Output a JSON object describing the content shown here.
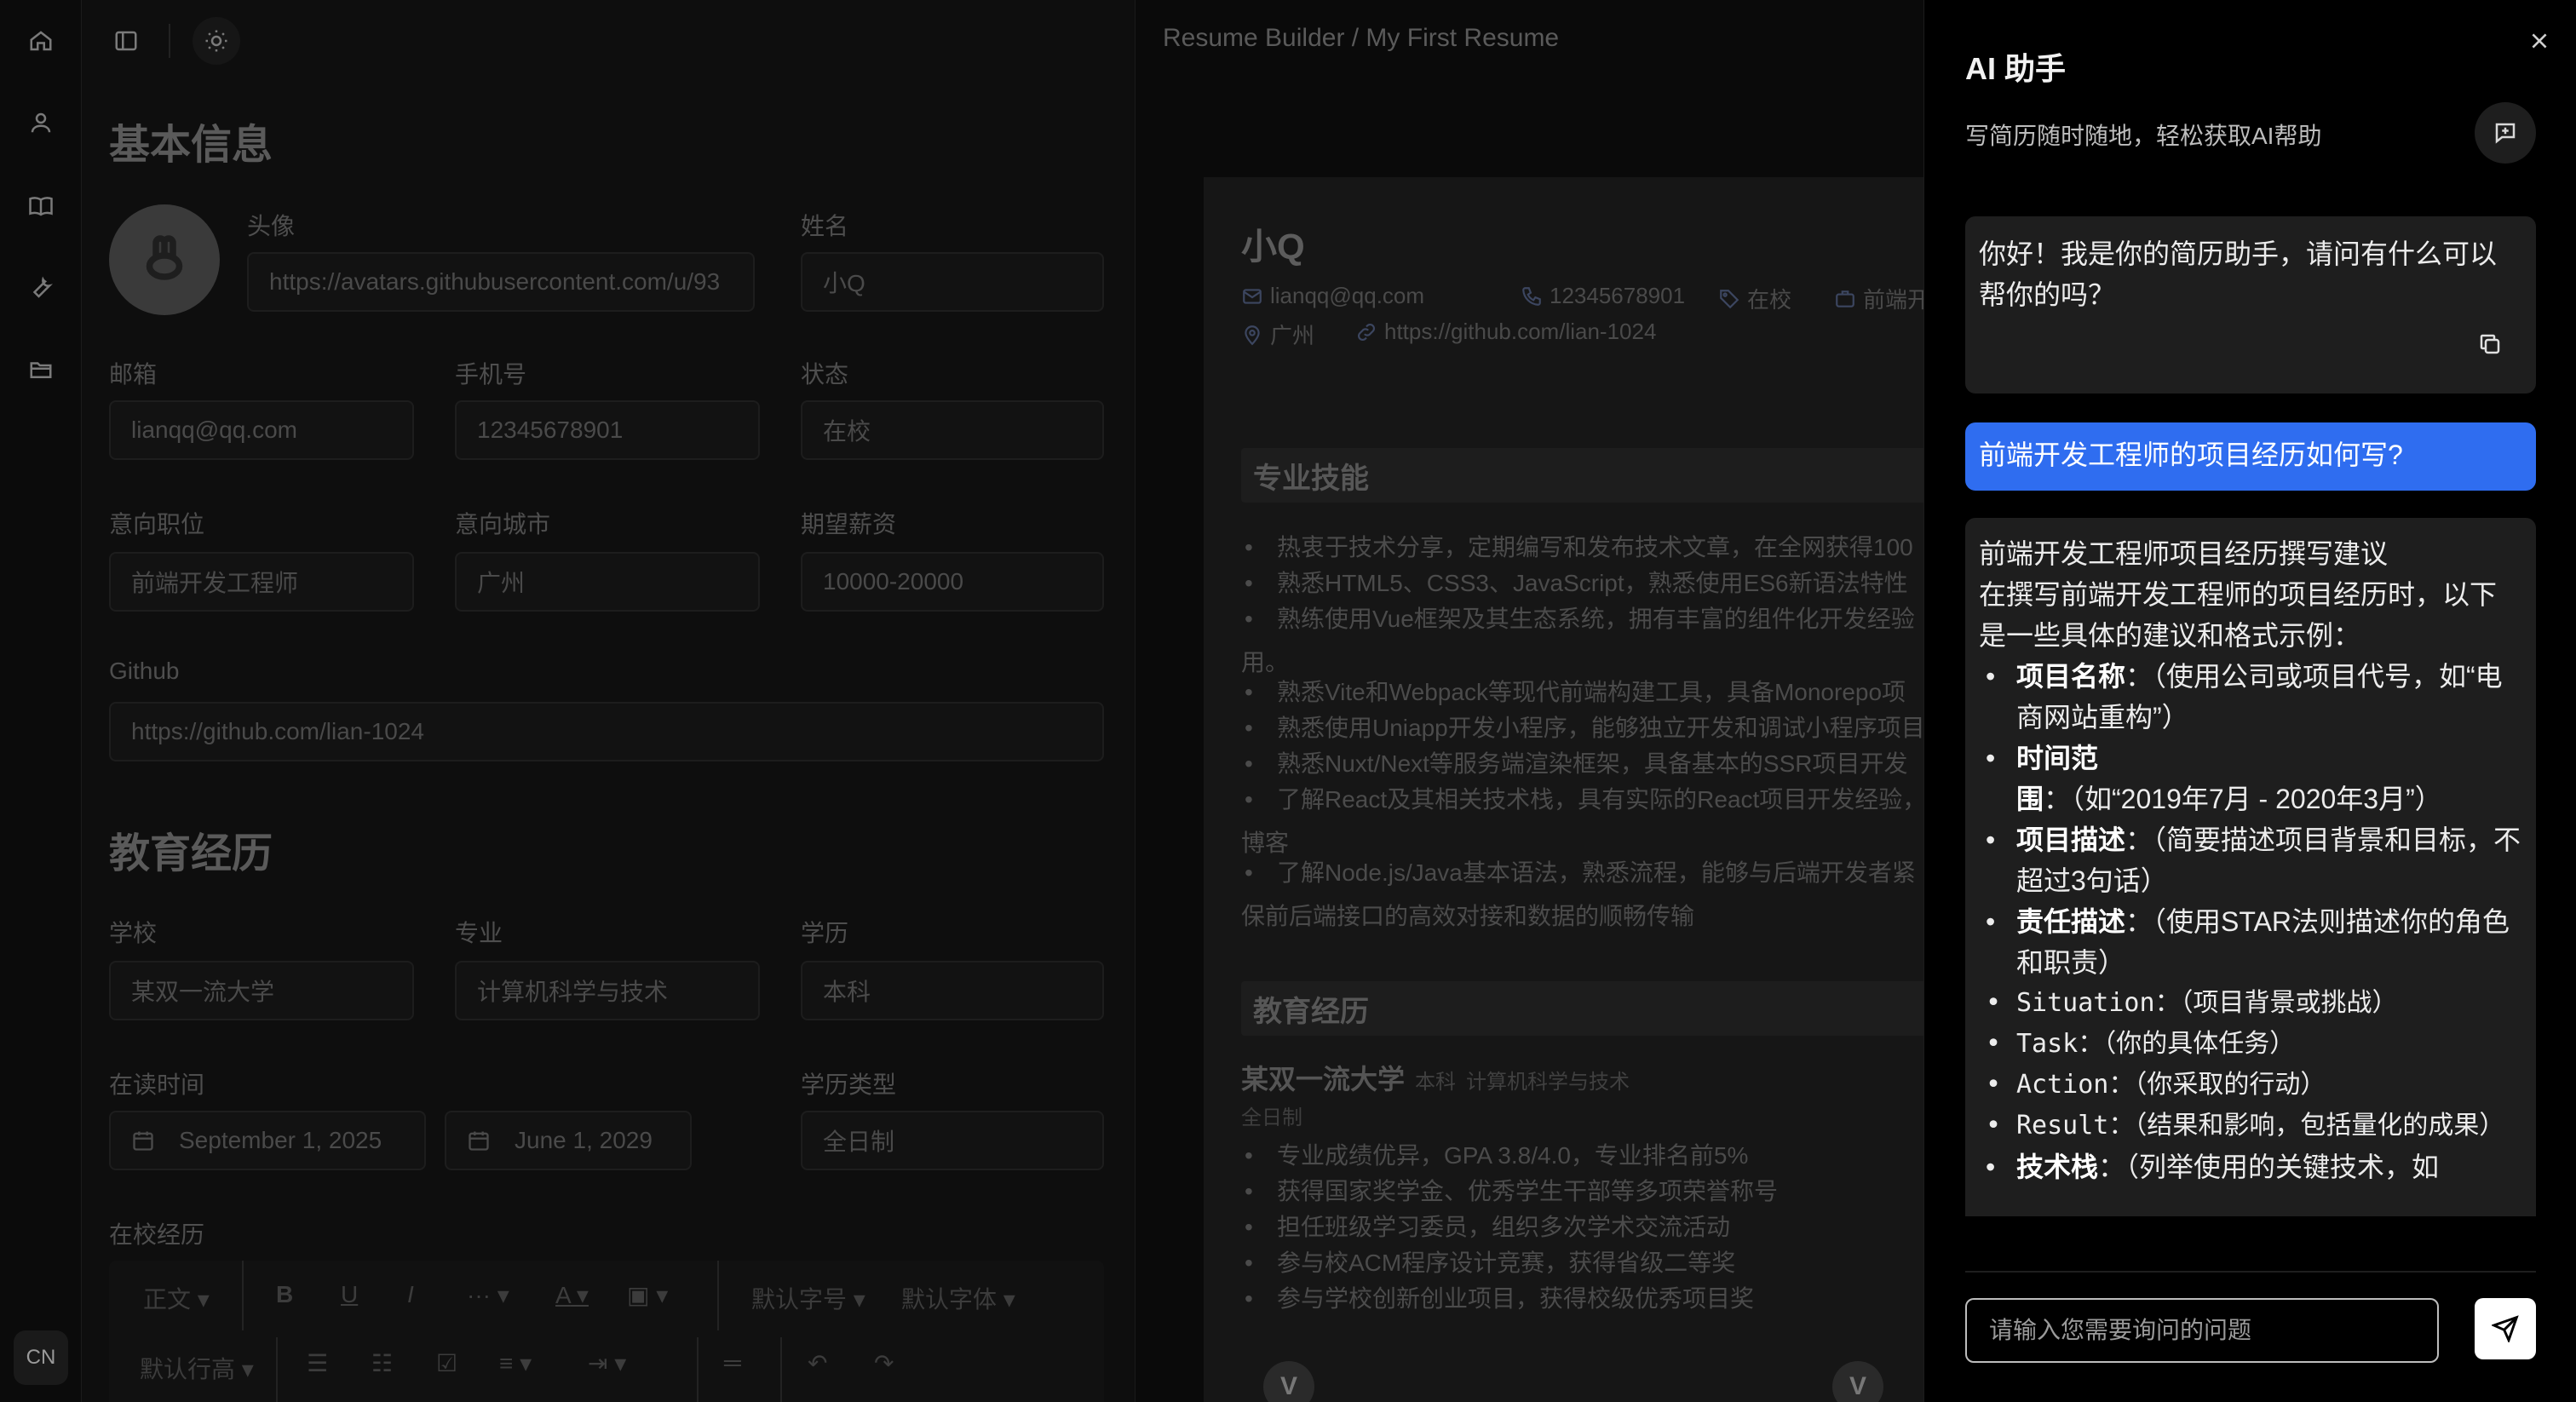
{
  "app": {
    "language_badge": "CN"
  },
  "rail": {
    "icons": [
      "home-icon",
      "user-icon",
      "book-icon",
      "wrench-icon",
      "folder-icon"
    ]
  },
  "form": {
    "basic_title": "基本信息",
    "avatar_label": "头像",
    "avatar_url": "https://avatars.githubusercontent.com/u/93",
    "name_label": "姓名",
    "name_value": "小Q",
    "email_label": "邮箱",
    "email_value": "lianqq@qq.com",
    "phone_label": "手机号",
    "phone_value": "12345678901",
    "status_label": "状态",
    "status_value": "在校",
    "position_label": "意向职位",
    "position_value": "前端开发工程师",
    "city_label": "意向城市",
    "city_value": "广州",
    "salary_label": "期望薪资",
    "salary_value": "10000-20000",
    "github_label": "Github",
    "github_value": "https://github.com/lian-1024",
    "edu_title": "教育经历",
    "school_label": "学校",
    "school_value": "某双一流大学",
    "major_label": "专业",
    "major_value": "计算机科学与技术",
    "degree_label": "学历",
    "degree_value": "本科",
    "period_label": "在读时间",
    "start_date": "September 1, 2025",
    "end_date": "June 1, 2029",
    "edu_type_label": "学历类型",
    "edu_type_value": "全日制",
    "campus_label": "在校经历",
    "toolbar": {
      "paragraph": "正文",
      "bold": "B",
      "underline": "U",
      "italic": "I",
      "more": "···",
      "font_color": "A",
      "default_size": "默认字号",
      "default_font": "默认字体",
      "default_line_height": "默认行高"
    }
  },
  "preview": {
    "breadcrumb": "Resume Builder / My First Resume",
    "name": "小Q",
    "email": "lianqq@qq.com",
    "phone": "12345678901",
    "status": "在校",
    "position": "前端开发工程",
    "city": "广州",
    "github": "https://github.com/lian-1024",
    "skills_title": "专业技能",
    "skills": [
      "热衷于技术分享，定期编写和发布技术文章，在全网获得100",
      "熟悉HTML5、CSS3、JavaScript，熟悉使用ES6新语法特性",
      "熟练使用Vue框架及其生态系统，拥有丰富的组件化开发经验",
      "熟悉Vite和Webpack等现代前端构建工具，具备Monorepo项",
      "熟悉使用Uniapp开发小程序，能够独立开发和调试小程序项目",
      "熟悉Nuxt/Next等服务端渲染框架，具备基本的SSR项目开发",
      "了解React及其相关技术栈，具有实际的React项目开发经验，",
      "了解Node.js/Java基本语法，熟悉流程，能够与后端开发者紧"
    ],
    "skill_cont_1": "用。",
    "skill_cont_2": "博客",
    "skill_cont_3": "保前后端接口的高效对接和数据的顺畅传输",
    "edu_title": "教育经历",
    "school": "某双一流大学",
    "degree": "本科",
    "major": "计算机科学与技术",
    "edu_type": "全日制",
    "achievements": [
      "专业成绩优异，GPA 3.8/4.0，专业排名前5%",
      "获得国家奖学金、优秀学生干部等多项荣誉称号",
      "担任班级学习委员，组织多次学术交流活动",
      "参与校ACM程序设计竞赛，获得省级二等奖",
      "参与学校创新创业项目，获得校级优秀项目奖"
    ],
    "nav_glyph": "V"
  },
  "assistant": {
    "title": "AI 助手",
    "subtitle": "写简历随时随地，轻松获取AI帮助",
    "greeting": "你好！我是你的简历助手，请问有什么可以帮你的吗？",
    "user_question": "前端开发工程师的项目经历如何写?",
    "answer_title": "前端开发工程师项目经历撰写建议",
    "answer_intro": "在撰写前端开发工程师的项目经历时，以下是一些具体的建议和格式示例：",
    "answer_items": [
      {
        "term": "项目名称",
        "text": "：（使用公司或项目代号，如“电商网站重构”）"
      },
      {
        "term": "时间范围",
        "text": "：（如“2019年7月 - 2020年3月”）"
      },
      {
        "term": "项目描述",
        "text": "：（简要描述项目背景和目标，不超过3句话）"
      },
      {
        "term": "责任描述",
        "text": "：（使用STAR法则描述你的角色和职责）"
      },
      {
        "term": "",
        "code": "Situation",
        "text": "：（项目背景或挑战）"
      },
      {
        "term": "",
        "code": "Task",
        "text": "：（你的具体任务）"
      },
      {
        "term": "",
        "code": "Action",
        "text": "：（你采取的行动）"
      },
      {
        "term": "",
        "code": "Result",
        "text": "：（结果和影响，包括量化的成果）"
      },
      {
        "term": "技术栈",
        "text": "：（列举使用的关键技术，如"
      }
    ],
    "input_placeholder": "请输入您需要询问的问题"
  }
}
